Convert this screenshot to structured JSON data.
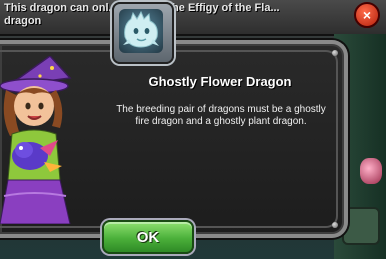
{
  "background": {
    "info_text": "This dragon can onl... ned with the Effigy of the Fla... dragon",
    "close_symbol": "×"
  },
  "dialog": {
    "title": "Ghostly Flower Dragon",
    "description": "The breeding pair of dragons must be a ghostly fire dragon and a ghostly plant dragon.",
    "ok_label": "OK",
    "portrait_icon": "ghostly-flower-dragon-icon",
    "character": "witch-girl-holding-dragon"
  },
  "colors": {
    "ok_green": "#4bb03a",
    "panel_dark": "#1f1f1f",
    "frame_grey": "#8a8a8a"
  }
}
